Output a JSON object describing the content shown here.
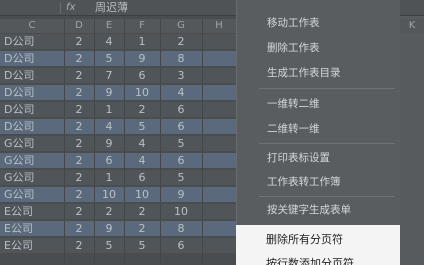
{
  "formula_bar": {
    "fx_label": "fx",
    "value": "周迟薄"
  },
  "columns": [
    "C",
    "D",
    "E",
    "F",
    "G",
    "H",
    "K"
  ],
  "rows": [
    {
      "company": "D公司",
      "d": "2",
      "e": "4",
      "f": "1",
      "g": "2"
    },
    {
      "company": "D公司",
      "d": "2",
      "e": "5",
      "f": "9",
      "g": "8"
    },
    {
      "company": "D公司",
      "d": "2",
      "e": "7",
      "f": "6",
      "g": "3"
    },
    {
      "company": "D公司",
      "d": "2",
      "e": "9",
      "f": "10",
      "g": "4"
    },
    {
      "company": "D公司",
      "d": "2",
      "e": "1",
      "f": "2",
      "g": "6"
    },
    {
      "company": "D公司",
      "d": "2",
      "e": "4",
      "f": "5",
      "g": "6"
    },
    {
      "company": "G公司",
      "d": "2",
      "e": "9",
      "f": "4",
      "g": "5"
    },
    {
      "company": "G公司",
      "d": "2",
      "e": "6",
      "f": "4",
      "g": "6"
    },
    {
      "company": "G公司",
      "d": "2",
      "e": "1",
      "f": "6",
      "g": "5"
    },
    {
      "company": "G公司",
      "d": "2",
      "e": "10",
      "f": "10",
      "g": "9"
    },
    {
      "company": "E公司",
      "d": "2",
      "e": "2",
      "f": "2",
      "g": "10"
    },
    {
      "company": "E公司",
      "d": "2",
      "e": "9",
      "f": "2",
      "g": "8"
    },
    {
      "company": "E公司",
      "d": "2",
      "e": "5",
      "f": "5",
      "g": "6"
    }
  ],
  "menu": {
    "items": [
      "移动工作表",
      "删除工作表",
      "生成工作表目录",
      "一维转二维",
      "二维转一维",
      "打印表标设置",
      "工作表转工作簿",
      "按关键字生成表单"
    ],
    "active_items": [
      "删除所有分页符",
      "按行数添加分页符"
    ]
  }
}
